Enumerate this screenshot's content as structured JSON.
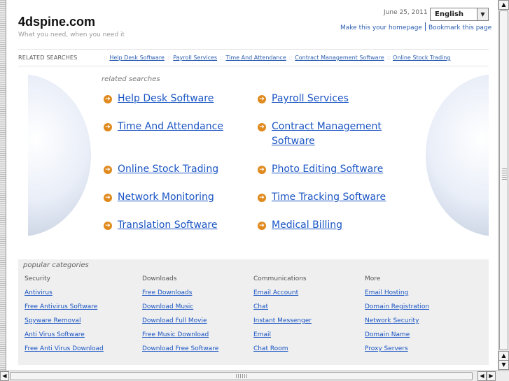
{
  "header": {
    "site_title": "4dspine.com",
    "tagline": "What you need, when you need it",
    "date": "June 25, 2011",
    "language": "English",
    "make_homepage": "Make this your homepage",
    "bookmark": "Bookmark this page"
  },
  "related_bar": {
    "label": "RELATED SEARCHES",
    "links": [
      "Help Desk Software",
      "Payroll Services",
      "Time And Attendance",
      "Contract Management Software",
      "Online Stock Trading"
    ]
  },
  "related_searches": {
    "heading": "related searches",
    "items": [
      "Help Desk Software",
      "Payroll Services",
      "Time And Attendance",
      "Contract Management Software",
      "Online Stock Trading",
      "Photo Editing Software",
      "Network Monitoring",
      "Time Tracking Software",
      "Translation Software",
      "Medical Billing"
    ]
  },
  "popular": {
    "heading": "popular categories",
    "columns": [
      {
        "title": "Security",
        "links": [
          "Antivirus",
          "Free Antivirus Software",
          "Spyware Removal",
          "Anti Virus Software",
          "Free Anti Virus Download"
        ]
      },
      {
        "title": "Downloads",
        "links": [
          "Free Downloads",
          "Download Music",
          "Download Full Movie",
          "Free Music Download",
          "Download Free Software"
        ]
      },
      {
        "title": "Communications",
        "links": [
          "Email Account",
          "Chat",
          "Instant Messenger",
          "Email",
          "Chat Room"
        ]
      },
      {
        "title": "More",
        "links": [
          "Email Hosting",
          "Domain Registration",
          "Network Security",
          "Domain Name",
          "Proxy Servers"
        ]
      }
    ]
  },
  "icons": {
    "arrow": "arrow-right-circle-icon",
    "arrow_color": "#e08a1e",
    "link_color": "#1a55c4"
  }
}
